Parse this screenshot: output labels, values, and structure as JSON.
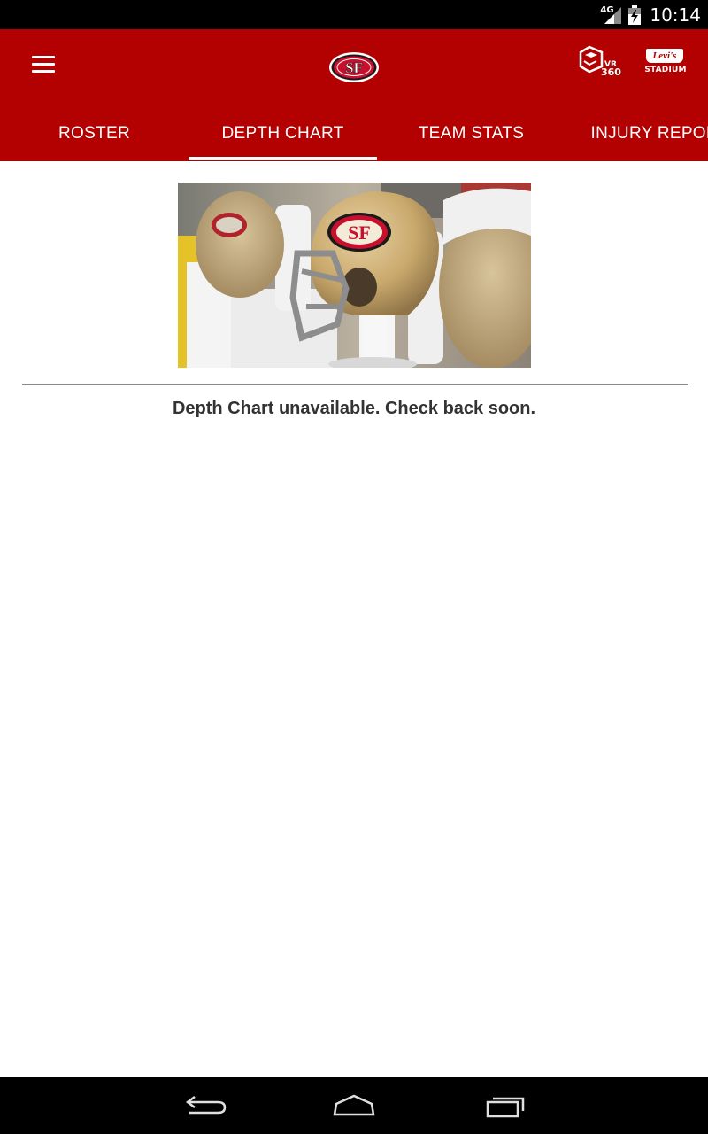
{
  "status_bar": {
    "network": "4G",
    "time": "10:14",
    "icons": [
      "signal-icon",
      "battery-icon"
    ]
  },
  "header": {
    "menu_icon": "hamburger-menu-icon",
    "logo": "49ers-sf-logo",
    "vr_button": "vr-360-icon",
    "stadium_button": {
      "brand": "Levi's",
      "label": "STADIUM"
    },
    "colors": {
      "header_background": "#b30000",
      "tab_text": "#ffffff",
      "indicator": "#ffffff"
    }
  },
  "tabs": [
    {
      "label": "ROSTER",
      "selected": false
    },
    {
      "label": "DEPTH CHART",
      "selected": true
    },
    {
      "label": "TEAM STATS",
      "selected": false
    },
    {
      "label": "INJURY REPORT",
      "selected": false
    }
  ],
  "main": {
    "image": "49ers-helmets-on-sideline",
    "message": "Depth Chart unavailable. Check back soon."
  },
  "nav_bar": {
    "icons": [
      "back-icon",
      "home-icon",
      "recents-icon"
    ]
  }
}
